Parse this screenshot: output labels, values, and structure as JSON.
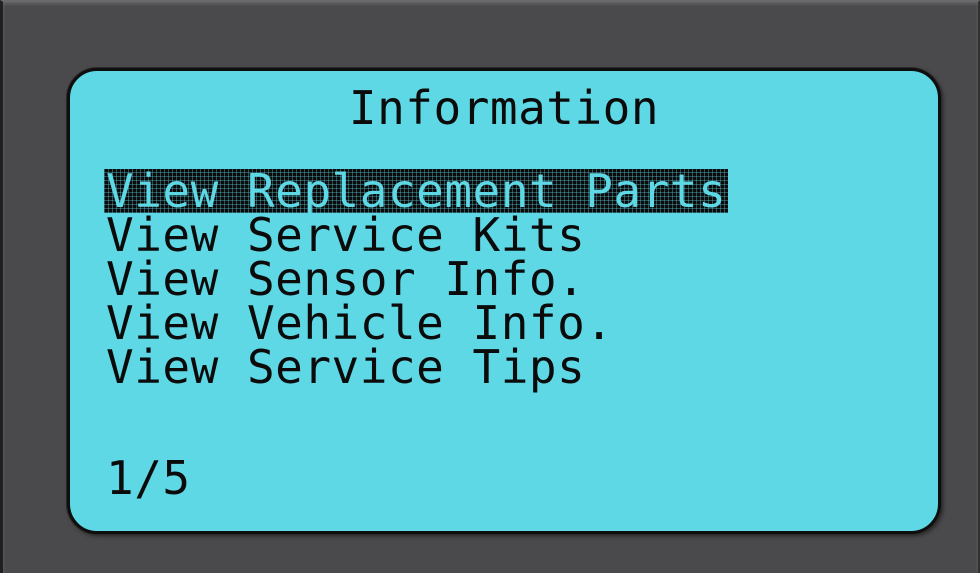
{
  "screen": {
    "title": "Information",
    "menu_items": [
      {
        "label": "View Replacement Parts",
        "selected": true
      },
      {
        "label": "View Service Kits",
        "selected": false
      },
      {
        "label": "View Sensor Info.",
        "selected": false
      },
      {
        "label": "View Vehicle Info.",
        "selected": false
      },
      {
        "label": "View Service Tips",
        "selected": false
      }
    ],
    "page_indicator": "1/5"
  },
  "colors": {
    "lcd_background": "#5fd8e6",
    "lcd_text": "#0b0b0b",
    "bezel": "#4a4a4c"
  }
}
